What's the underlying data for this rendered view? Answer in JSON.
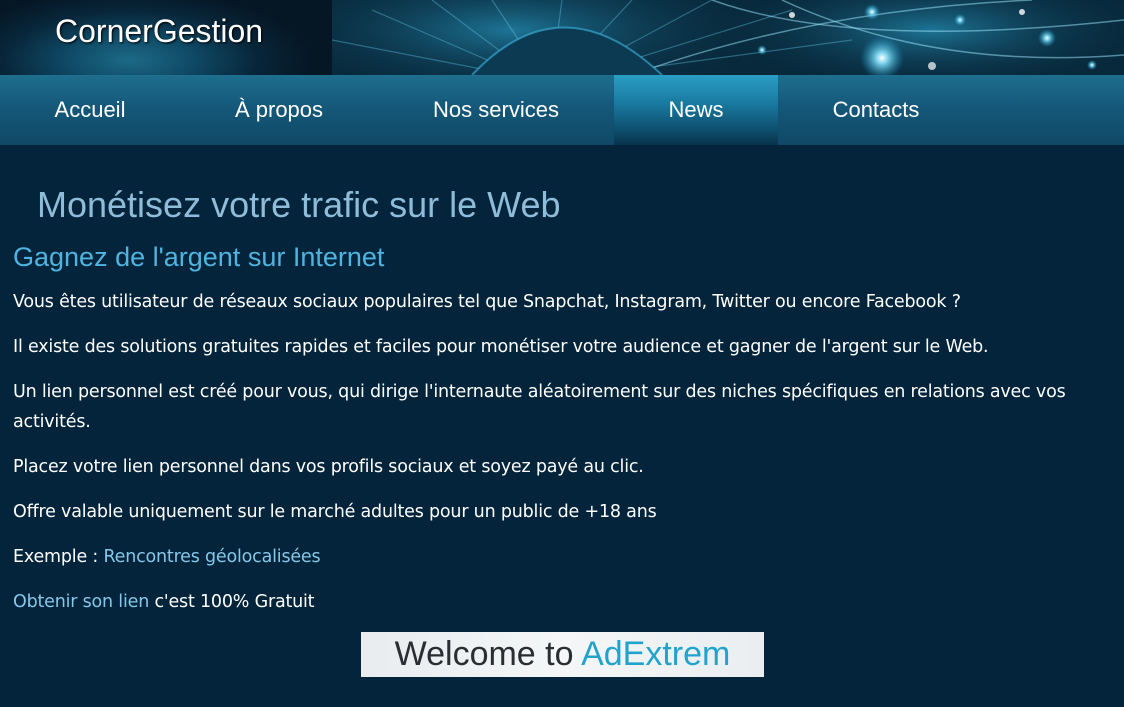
{
  "header": {
    "site_title": "CornerGestion"
  },
  "nav": {
    "items": [
      {
        "label": "Accueil"
      },
      {
        "label": "À propos"
      },
      {
        "label": "Nos services"
      },
      {
        "label": "News",
        "active": true
      },
      {
        "label": "Contacts"
      }
    ]
  },
  "main": {
    "page_title": "Monétisez votre trafic sur le Web",
    "subtitle": "Gagnez de l'argent sur Internet",
    "paragraphs": [
      "Vous êtes utilisateur de réseaux sociaux populaires tel que Snapchat, Instagram, Twitter ou encore Facebook ?",
      "Il existe des solutions gratuites rapides et faciles pour monétiser votre audience et gagner de l'argent sur le Web.",
      "Un lien personnel est créé pour vous, qui dirige l'internaute aléatoirement sur des niches spécifiques en relations avec vos activités.",
      "Placez votre lien personnel dans vos profils sociaux et soyez payé au clic.",
      "Offre valable uniquement sur le marché adultes pour un public de +18 ans"
    ],
    "example": {
      "prefix": "Exemple : ",
      "link_label": "Rencontres géolocalisées"
    },
    "cta": {
      "link_label": "Obtenir son lien",
      "suffix": " c'est 100% Gratuit"
    },
    "banner": {
      "text_prefix": "Welcome to ",
      "brand": "AdExtrem"
    }
  },
  "colors": {
    "background": "#03243a",
    "nav": "#15587a",
    "nav_active": "#1a7aa0",
    "heading": "#8fbcd9",
    "subheading": "#4fb4e0",
    "link": "#86c8ea",
    "brand": "#22a3cc"
  }
}
